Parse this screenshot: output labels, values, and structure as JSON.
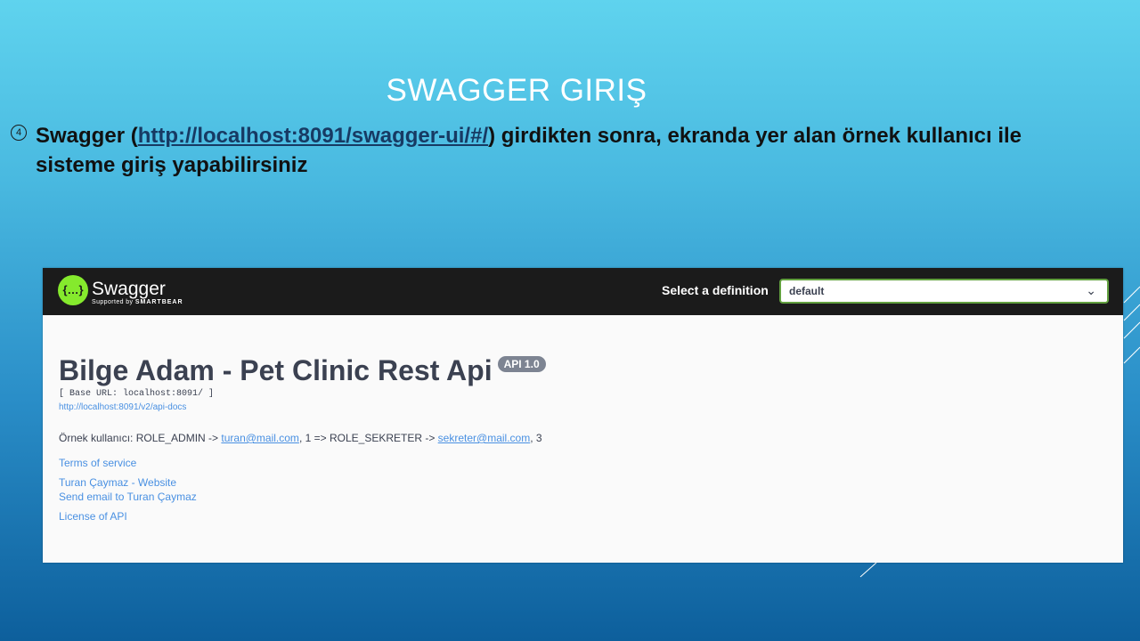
{
  "slide": {
    "title": "SWAGGER GIRIŞ",
    "bullet_marker": "4",
    "bullet_prefix": "Swagger (",
    "bullet_link": "http://localhost:8091/swagger-ui/#/",
    "bullet_suffix": ") girdikten sonra, ekranda yer alan örnek kullanıcı ile sisteme giriş yapabilirsiniz"
  },
  "swagger": {
    "brand": "Swagger",
    "supported_by": "Supported by",
    "smartbear": "SMARTBEAR",
    "logo_glyph": "{…}",
    "select_label": "Select a definition",
    "select_value": "default",
    "title": "Bilge Adam - Pet Clinic Rest Api",
    "version": "API 1.0",
    "base_url": "[ Base URL: localhost:8091/ ]",
    "api_docs_link": "http://localhost:8091/v2/api-docs",
    "description": {
      "part1": "Örnek kullanıcı: ROLE_ADMIN -> ",
      "email1": "turan@mail.com",
      "part2": ", 1 => ROLE_SEKRETER -> ",
      "email2": "sekreter@mail.com",
      "part3": ", 3"
    },
    "terms": "Terms of service",
    "website": "Turan Çaymaz - Website",
    "send_email": "Send email to Turan Çaymaz",
    "license": "License of API"
  },
  "colors": {
    "swagger_green": "#85ea2d",
    "topbar": "#1b1b1b",
    "link": "#4990e2"
  }
}
